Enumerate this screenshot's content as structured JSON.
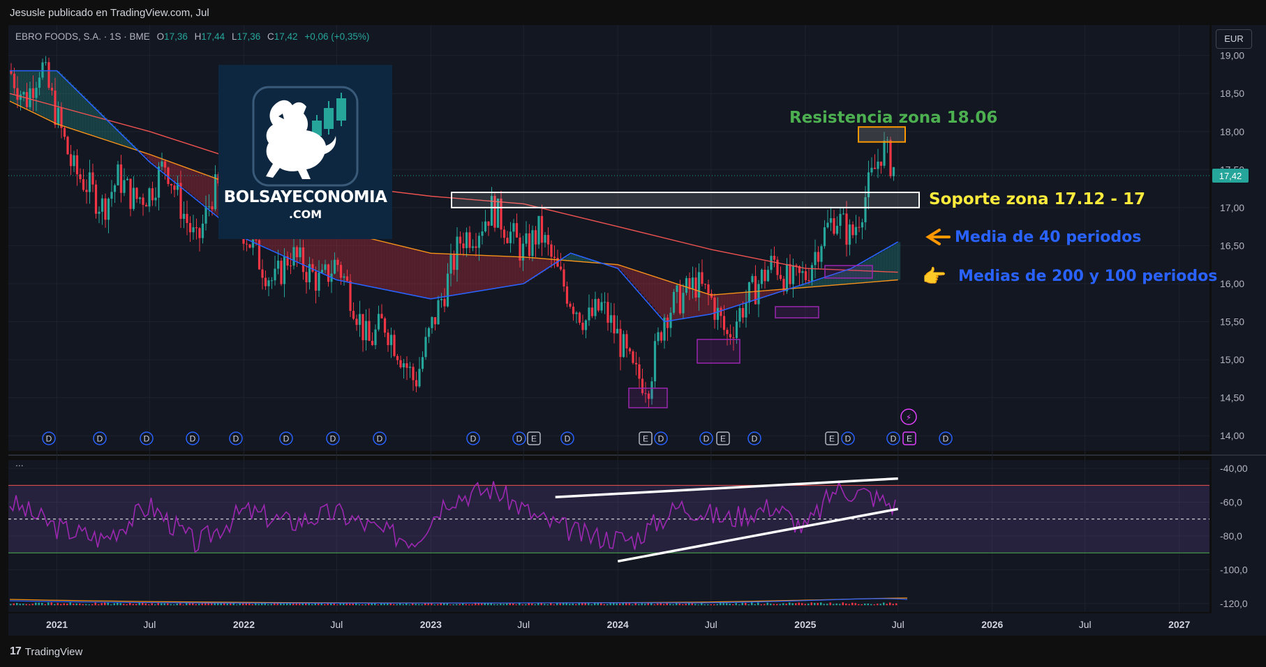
{
  "header": {
    "publisher": "Jesusle publicado en TradingView.com, Jul"
  },
  "legend": {
    "symbol": "EBRO FOODS, S.A. · 1S · BME",
    "open_label": "O",
    "open": "17,36",
    "high_label": "H",
    "high": "17,44",
    "low_label": "L",
    "low": "17,36",
    "close_label": "C",
    "close": "17,42",
    "change": "+0,06 (+0,35%)"
  },
  "currency": "EUR",
  "last_price": "17,42",
  "logo": {
    "line1": "BOLSAYECONOMIA",
    "line2": ".COM"
  },
  "annotations": {
    "resistance": "Resistencia zona 18.06",
    "support": "Soporte zona 17.12 - 17",
    "ma40": "Media de 40 periodos",
    "ma200_100": "Medias de 200 y 100 periodos"
  },
  "pane_menu": "...",
  "footer": {
    "brand": "TradingView"
  },
  "colors": {
    "up": "#26a69a",
    "down": "#f23645",
    "ma40": "#2962ff",
    "ma100": "#f7931a",
    "ma200": "#ef5350",
    "oscillator": "#9c27b0",
    "resistance_text": "#4caf50",
    "support_text": "#ffeb3b",
    "ma_text": "#2962ff",
    "arrow": "#ff9800"
  },
  "chart_data": [
    {
      "type": "candlestick",
      "title": "EBRO FOODS, S.A. · 1S · BME",
      "interval": "1W",
      "y_axis_ticks": [
        "19,00",
        "18,50",
        "18,00",
        "17,50",
        "17,00",
        "16,50",
        "16,00",
        "15,50",
        "15,00",
        "14,50",
        "14,00"
      ],
      "ylim": [
        13.8,
        19.4
      ],
      "x_axis_ticks": [
        "2021",
        "Jul",
        "2022",
        "Jul",
        "2023",
        "Jul",
        "2024",
        "Jul",
        "2025",
        "Jul",
        "2026",
        "Jul",
        "2027"
      ],
      "close_path": [
        [
          "2020-10",
          18.8
        ],
        [
          "2020-11",
          18.4
        ],
        [
          "2020-12",
          18.9
        ],
        [
          "2021-01",
          18.2
        ],
        [
          "2021-02",
          17.5
        ],
        [
          "2021-03",
          17.3
        ],
        [
          "2021-04",
          17.0
        ],
        [
          "2021-05",
          17.4
        ],
        [
          "2021-06",
          17.1
        ],
        [
          "2021-07",
          17.2
        ],
        [
          "2021-08",
          17.6
        ],
        [
          "2021-09",
          17.0
        ],
        [
          "2021-10",
          16.5
        ],
        [
          "2021-11",
          17.2
        ],
        [
          "2021-12",
          17.3
        ],
        [
          "2022-01",
          16.7
        ],
        [
          "2022-02",
          16.3
        ],
        [
          "2022-03",
          16.0
        ],
        [
          "2022-04",
          16.4
        ],
        [
          "2022-05",
          16.2
        ],
        [
          "2022-06",
          16.0
        ],
        [
          "2022-07",
          16.3
        ],
        [
          "2022-08",
          15.8
        ],
        [
          "2022-09",
          15.2
        ],
        [
          "2022-10",
          15.5
        ],
        [
          "2022-11",
          15.1
        ],
        [
          "2022-12",
          14.7
        ],
        [
          "2023-01",
          15.4
        ],
        [
          "2023-02",
          16.0
        ],
        [
          "2023-03",
          16.6
        ],
        [
          "2023-04",
          16.7
        ],
        [
          "2023-05",
          17.0
        ],
        [
          "2023-06",
          16.7
        ],
        [
          "2023-07",
          16.4
        ],
        [
          "2023-08",
          16.7
        ],
        [
          "2023-09",
          16.2
        ],
        [
          "2023-10",
          15.8
        ],
        [
          "2023-11",
          15.5
        ],
        [
          "2023-12",
          15.7
        ],
        [
          "2024-01",
          15.3
        ],
        [
          "2024-02",
          14.8
        ],
        [
          "2024-03",
          14.7
        ],
        [
          "2024-04",
          15.6
        ],
        [
          "2024-05",
          15.8
        ],
        [
          "2024-06",
          16.0
        ],
        [
          "2024-07",
          15.8
        ],
        [
          "2024-08",
          15.3
        ],
        [
          "2024-09",
          15.7
        ],
        [
          "2024-10",
          16.0
        ],
        [
          "2024-11",
          16.3
        ],
        [
          "2024-12",
          16.0
        ],
        [
          "2025-01",
          16.1
        ],
        [
          "2025-02",
          16.6
        ],
        [
          "2025-03",
          16.9
        ],
        [
          "2025-04",
          16.6
        ],
        [
          "2025-05",
          17.2
        ],
        [
          "2025-06",
          17.8
        ],
        [
          "2025-07",
          17.42
        ]
      ],
      "ma40_path": [
        [
          "2020-10",
          18.8
        ],
        [
          "2021-01",
          18.8
        ],
        [
          "2021-07",
          17.6
        ],
        [
          "2022-01",
          16.6
        ],
        [
          "2022-07",
          16.05
        ],
        [
          "2023-01",
          15.8
        ],
        [
          "2023-07",
          16.0
        ],
        [
          "2023-10",
          16.4
        ],
        [
          "2024-01",
          16.2
        ],
        [
          "2024-04",
          15.5
        ],
        [
          "2024-07",
          15.6
        ],
        [
          "2024-10",
          15.8
        ],
        [
          "2025-01",
          16.0
        ],
        [
          "2025-04",
          16.2
        ],
        [
          "2025-07",
          16.55
        ]
      ],
      "ma100_path": [
        [
          "2020-10",
          18.4
        ],
        [
          "2021-01",
          18.1
        ],
        [
          "2021-07",
          17.7
        ],
        [
          "2022-01",
          17.25
        ],
        [
          "2022-07",
          16.7
        ],
        [
          "2023-01",
          16.4
        ],
        [
          "2023-07",
          16.35
        ],
        [
          "2024-01",
          16.25
        ],
        [
          "2024-07",
          15.85
        ],
        [
          "2025-01",
          15.95
        ],
        [
          "2025-07",
          16.05
        ]
      ],
      "ma200_path": [
        [
          "2020-10",
          18.5
        ],
        [
          "2021-07",
          18.0
        ],
        [
          "2022-01",
          17.6
        ],
        [
          "2022-07",
          17.3
        ],
        [
          "2023-01",
          17.15
        ],
        [
          "2023-07",
          17.05
        ],
        [
          "2024-01",
          16.75
        ],
        [
          "2024-07",
          16.45
        ],
        [
          "2025-01",
          16.2
        ],
        [
          "2025-07",
          16.15
        ]
      ],
      "zones": [
        {
          "label": "Resistencia zona 18.06",
          "from": "2025-05",
          "to": "2025-07",
          "low": 17.9,
          "high": 18.06
        },
        {
          "label": "Soporte zona 17.12 - 17",
          "from": "2023-01",
          "to": "2025-07",
          "low": 17.0,
          "high": 17.2
        }
      ],
      "last_price": 17.42,
      "event_markers": [
        "D",
        "D",
        "D",
        "D",
        "D",
        "D",
        "D",
        "D",
        "D",
        "D",
        "E",
        "D",
        "E",
        "D",
        "D",
        "E",
        "D",
        "E",
        "D",
        "D",
        "E",
        "D"
      ]
    },
    {
      "type": "line",
      "name": "oscillator",
      "y_axis_ticks": [
        "-40,00",
        "-60,0",
        "-80,0",
        "-100,0",
        "-120,0"
      ],
      "ylim": [
        -125,
        -35
      ],
      "upper_band": -50,
      "lower_band": -90,
      "middle": -70,
      "path": [
        [
          "2020-10",
          -60
        ],
        [
          "2021-01",
          -75
        ],
        [
          "2021-04",
          -82
        ],
        [
          "2021-07",
          -62
        ],
        [
          "2021-10",
          -85
        ],
        [
          "2022-01",
          -65
        ],
        [
          "2022-04",
          -72
        ],
        [
          "2022-07",
          -66
        ],
        [
          "2022-10",
          -78
        ],
        [
          "2022-12",
          -82
        ],
        [
          "2023-02",
          -58
        ],
        [
          "2023-05",
          -52
        ],
        [
          "2023-08",
          -70
        ],
        [
          "2023-11",
          -80
        ],
        [
          "2024-02",
          -82
        ],
        [
          "2024-05",
          -62
        ],
        [
          "2024-08",
          -70
        ],
        [
          "2024-11",
          -62
        ],
        [
          "2025-01",
          -76
        ],
        [
          "2025-03",
          -52
        ],
        [
          "2025-05",
          -55
        ],
        [
          "2025-07",
          -63
        ]
      ],
      "trendlines": [
        {
          "from": [
            "2023-09",
            -57
          ],
          "to": [
            "2025-07",
            -46
          ]
        },
        {
          "from": [
            "2024-01",
            -95
          ],
          "to": [
            "2025-07",
            -64
          ]
        }
      ]
    }
  ]
}
